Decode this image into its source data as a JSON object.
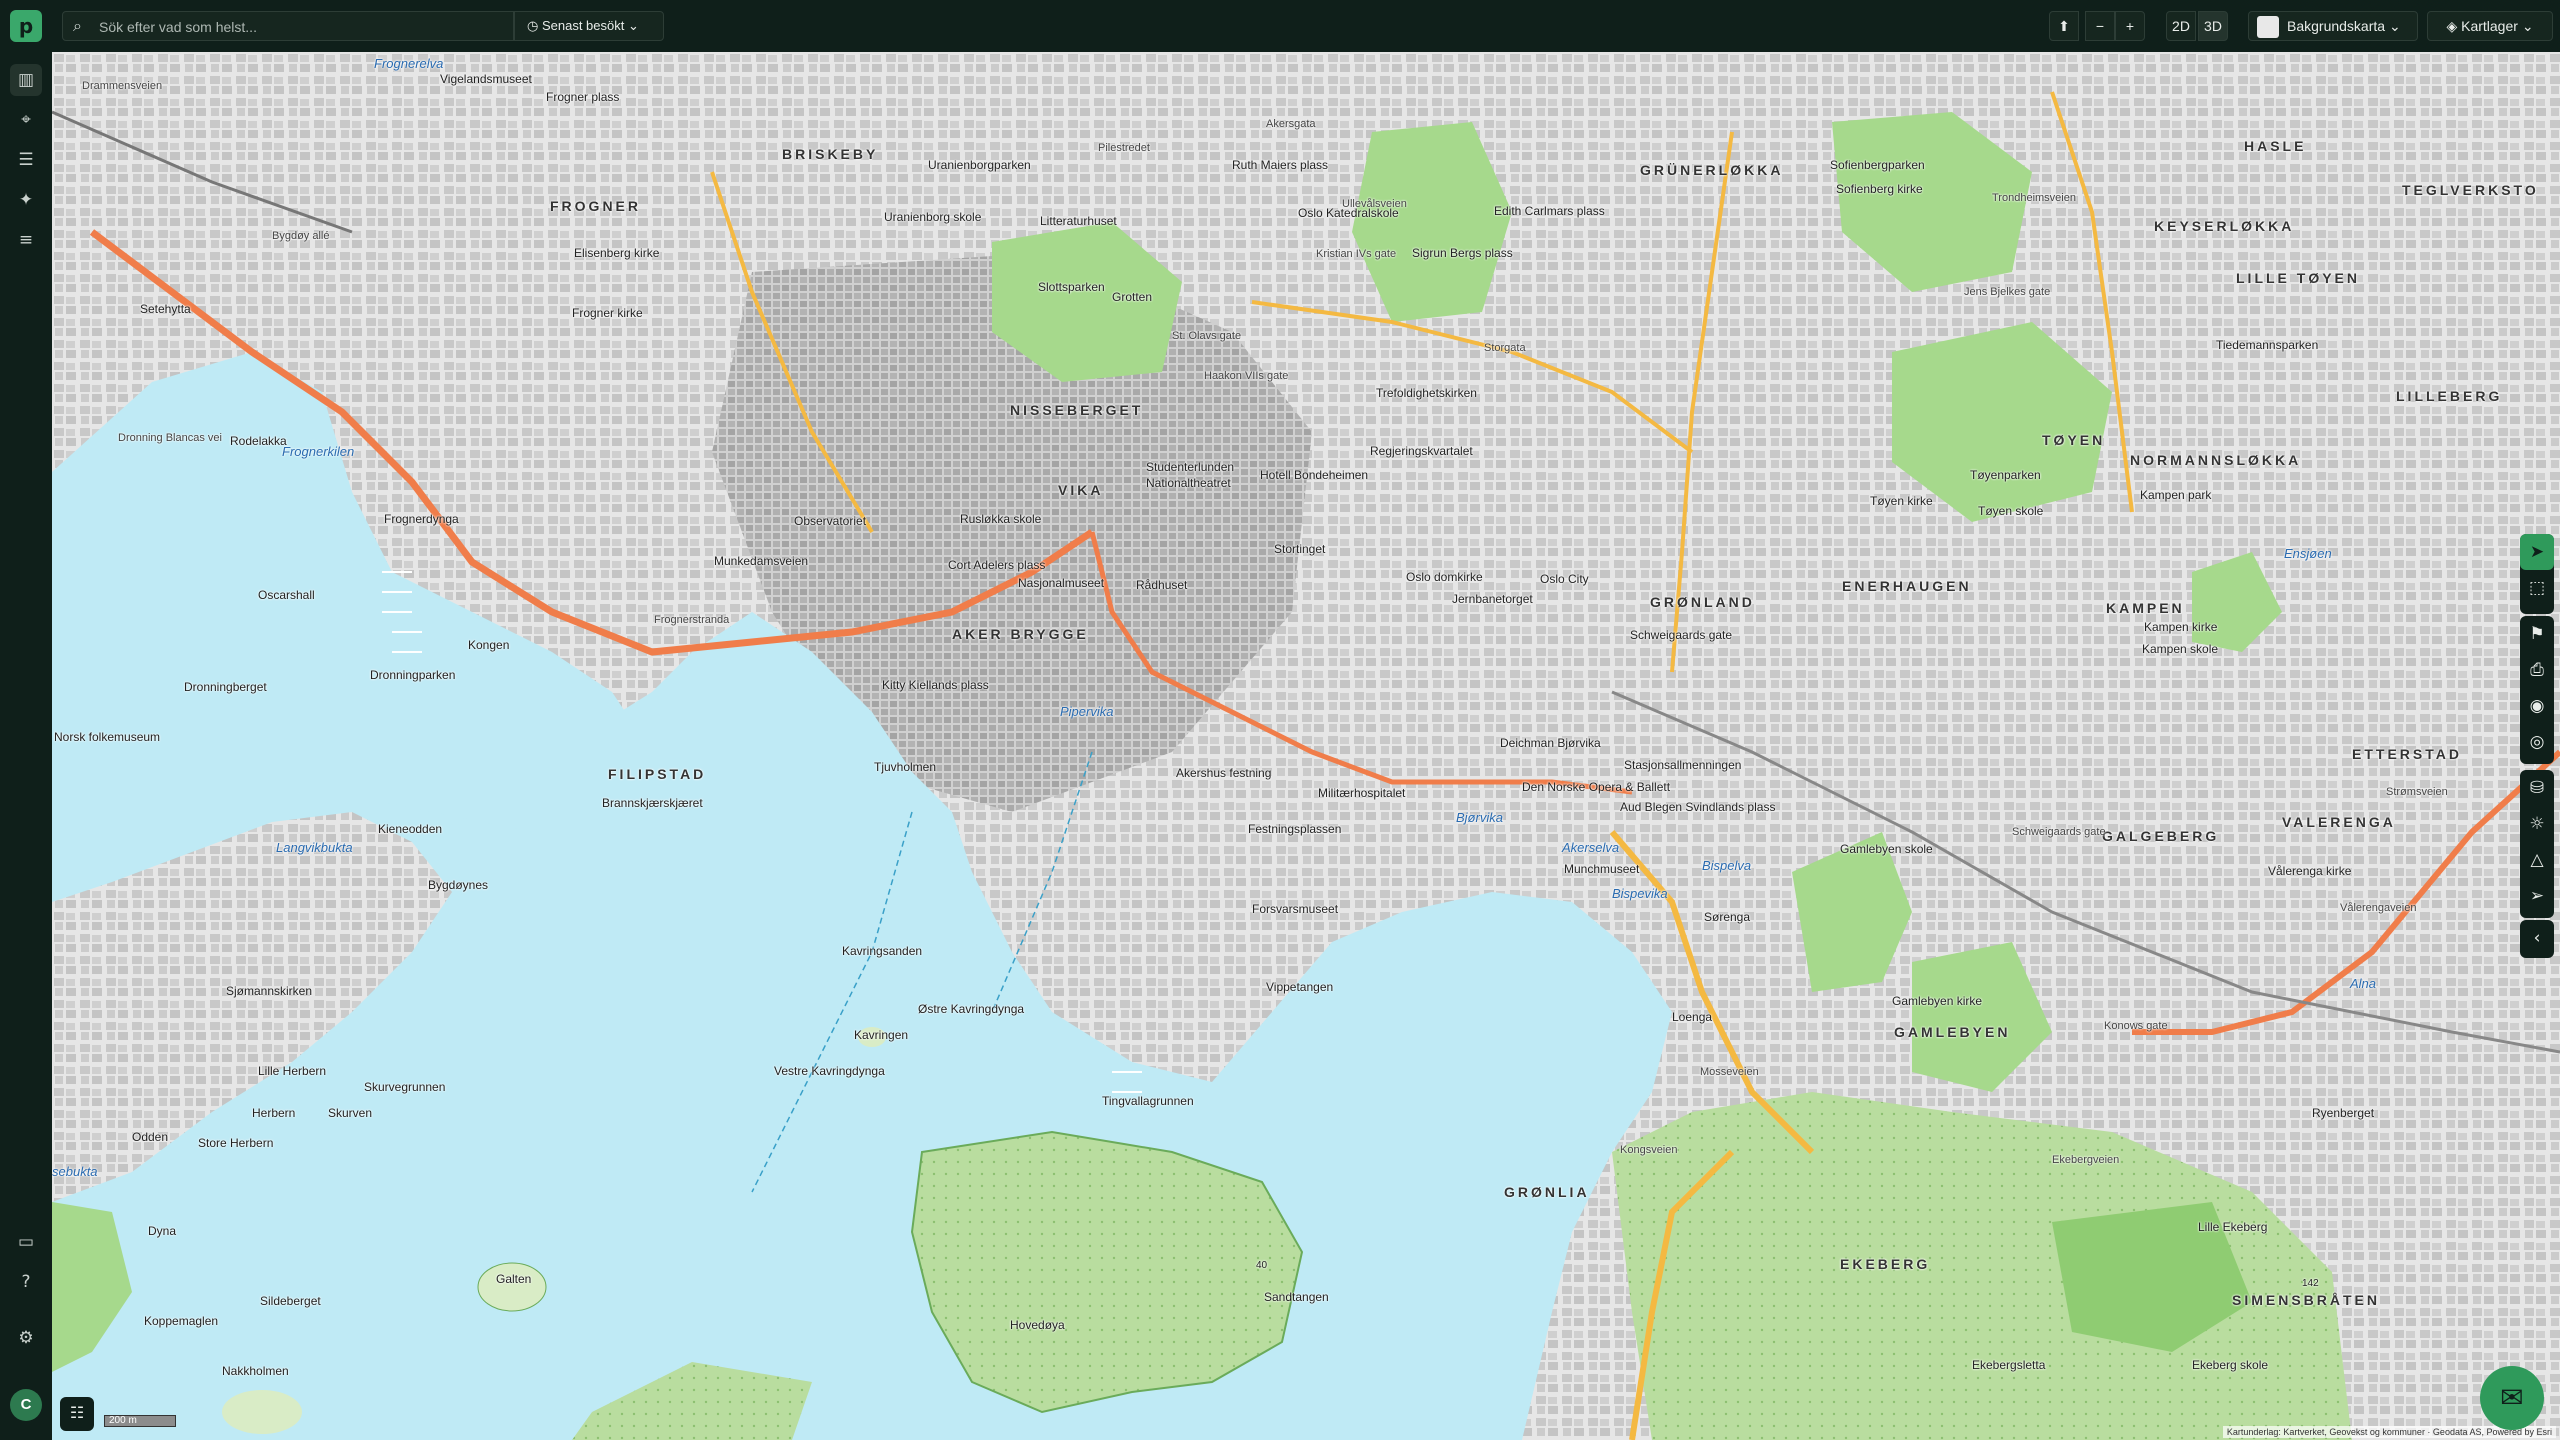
{
  "topbar": {
    "logo_letter": "p",
    "search_placeholder": "Sök efter vad som helst...",
    "recent_label": "Senast besökt",
    "compass": "⬆",
    "zoom_out": "−",
    "zoom_in": "+",
    "mode_2d": "2D",
    "mode_3d": "3D",
    "basemap_label": "Bakgrundskarta",
    "layers_label": "Kartlager"
  },
  "sidebar": {
    "items": [
      "map-icon",
      "tag-icon",
      "list-icon",
      "sparkle-icon",
      "filter-icon"
    ],
    "bottom": [
      "comment-icon",
      "help-icon",
      "widget-icon"
    ],
    "avatar": "C"
  },
  "map": {
    "districts": [
      "BRISKEBY",
      "FROGNER",
      "GRÜNERLØKKA",
      "HASLE",
      "KEYSERLØKKA",
      "TEGLVERKSTO",
      "LILLE TØYEN",
      "LILLEBERG",
      "TØYEN",
      "NORMANNSLØKKA",
      "ENERHAUGEN",
      "KAMPEN",
      "GRØNLAND",
      "AKER BRYGGE",
      "FILIPSTAD",
      "VIKA",
      "ETTERSTAD",
      "VALERENGA",
      "GALGEBERG",
      "GAMLEBYEN",
      "EKEBERG",
      "SIMENSBRÅTEN",
      "GRØNLIA",
      "NISSEBERGET"
    ],
    "water_labels": [
      "Frognerkilen",
      "Pipervika",
      "Bjørvika",
      "Akerselva",
      "Bispevika",
      "Langvikbukta",
      "Frognerelva",
      "Alna",
      "Ensjøen",
      "Bispelva",
      "sebukta"
    ],
    "places": [
      "Vigelandsmuseet",
      "Frogner plass",
      "Uranienborgparken",
      "Uranienborg skole",
      "Elisenberg kirke",
      "Frogner kirke",
      "Rodelakka",
      "Frognerdynga",
      "Oscarshall",
      "Kongen",
      "Dronningparken",
      "Setehytta",
      "Dronningberget",
      "Norsk folkemuseum",
      "Kieneodden",
      "Bygdøynes",
      "Sjømannskirken",
      "Lille Herbern",
      "Herbern",
      "Store Herbern",
      "Skurvegrunnen",
      "Skurven",
      "Odden",
      "Dyna",
      "Galten",
      "Sildeberget",
      "Koppemaglen",
      "Nakkholmen",
      "Slottsparken",
      "Litteraturhuset",
      "Grotten",
      "Ruth Maiers plass",
      "Oslo Katedralskole",
      "Sigrun Bergs plass",
      "Edith Carlmars plass",
      "Sofienberg kirke",
      "Sofienbergparken",
      "Oslo domkirke",
      "Stortinget",
      "Nationaltheatret",
      "Studenterlunden",
      "Hotell Bondeheimen",
      "Regjeringskvartalet",
      "Trefoldighetskirken",
      "Rådhuset",
      "Nasjonalmuseet",
      "Cort Adelers plass",
      "Rusløkka skole",
      "Observatoriet",
      "Munkedamsveien",
      "Kitty Kiellands plass",
      "Tjuvholmen",
      "Brannskjærskjæret",
      "Akershus festning",
      "Festningsplassen",
      "Forsvarsmuseet",
      "Vippetangen",
      "Militærhospitalet",
      "Den Norske Opera & Ballett",
      "Munchmuseet",
      "Deichman Bjørvika",
      "Stasjonsallmenningen",
      "Schweigaards gate",
      "Aud Blegen Svindlands plass",
      "Oslo City",
      "Jernbanetorget",
      "Tøyen kirke",
      "Tøyen skole",
      "Kampen kirke",
      "Kampen skole",
      "Kampen park",
      "Tøyenparken",
      "Tiedemannsparken",
      "Vålerenga kirke",
      "Gamlebyen skole",
      "Gamlebyen kirke",
      "Loenga",
      "Sørenga",
      "Kavringsanden",
      "Østre Kavringdynga",
      "Kavringen",
      "Vestre Kavringdynga",
      "Tingvallagrunnen",
      "Hovedøya",
      "Sandtangen",
      "Lille Ekeberg",
      "Ekebergsletta",
      "Ekeberg skole",
      "Ryenberget"
    ],
    "roads": [
      "Bygdøy allé",
      "Frognerstranda",
      "Drammensveien",
      "Haakon VIIs gate",
      "Kristian IVs gate",
      "Akersgata",
      "Storgata",
      "Kongsveien",
      "Mosseveien",
      "Schweigaards gate",
      "Strømsveien",
      "Konows gate",
      "Vålerengaveien",
      "Jens Bjelkes gate",
      "Trondheimsveien",
      "Ekebergveien",
      "Dronning Blancas vei",
      "St. Olavs gate",
      "Pilestredet",
      "Ullevålsveien"
    ],
    "numbers": [
      "142",
      "40"
    ],
    "scale_label": "200 m",
    "attribution": "Kartunderlag: Kartverket, Geovekst og kommuner · Geodata AS, Powered by Esri"
  },
  "right_tools": [
    "pointer-icon",
    "select-box-icon",
    "bookmark-icon",
    "print-icon",
    "camera-icon",
    "locate-icon",
    "measure-icon",
    "sun-icon",
    "triangle-icon",
    "send-icon",
    "collapse-icon"
  ],
  "colors": {
    "chrome": "#0f1f1a",
    "accent": "#2f9a5b",
    "water": "#bfeaf5",
    "park": "#a6d98c",
    "highway": "#f07d4a",
    "road_yellow": "#f4b942"
  }
}
